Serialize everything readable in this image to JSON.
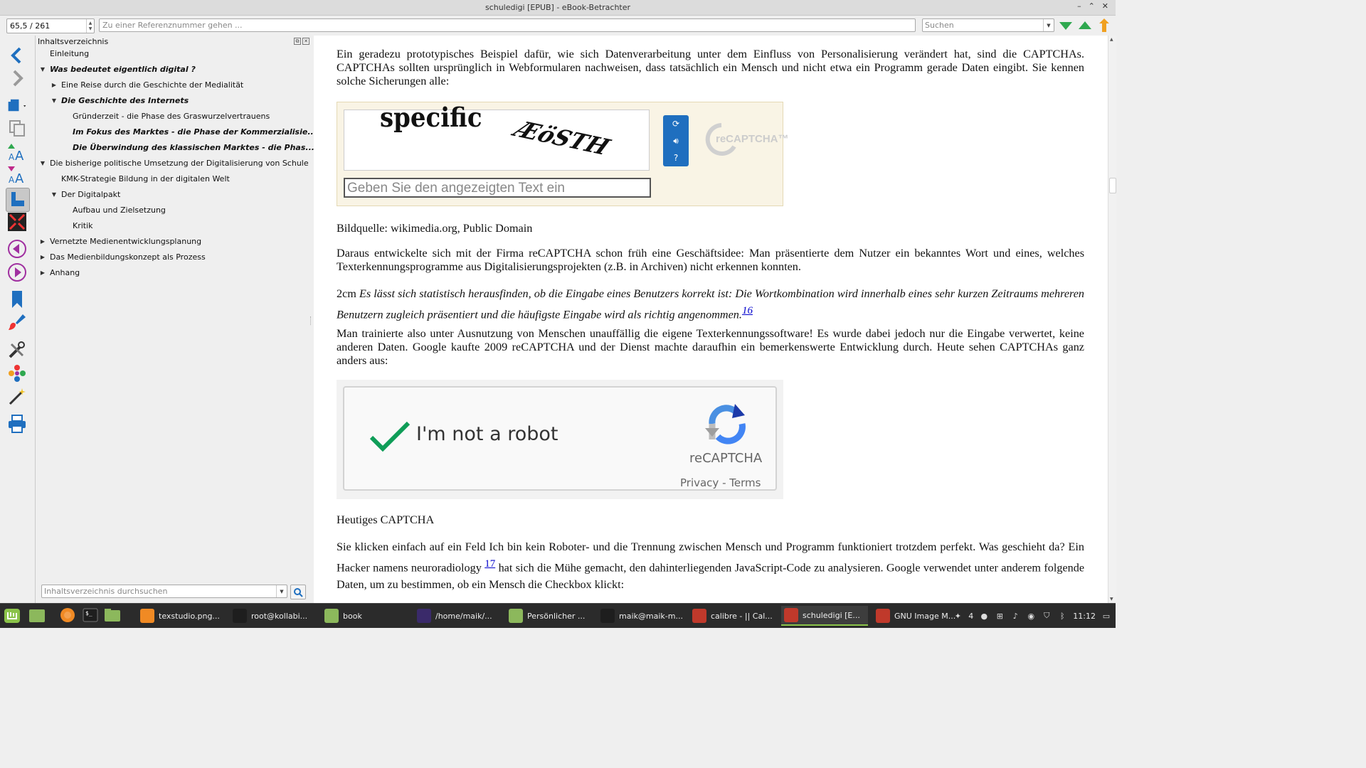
{
  "window": {
    "title": "schuledigi [EPUB] - eBook-Betrachter",
    "controls": [
      "–",
      "⌃",
      "✕"
    ]
  },
  "toolbar": {
    "page_position": "65,5 / 261",
    "reference_placeholder": "Zu einer Referenznummer gehen ...",
    "search_placeholder": "Suchen"
  },
  "toc": {
    "header": "Inhaltsverzeichnis",
    "search_placeholder": "Inhaltsverzeichnis durchsuchen",
    "items": [
      {
        "label": "Einleitung",
        "level": 0,
        "arrow": "",
        "bold": false
      },
      {
        "label": "Was bedeutet eigentlich digital ?",
        "level": 0,
        "arrow": "▼",
        "bold": true
      },
      {
        "label": "Eine Reise durch die Geschichte der Medialität",
        "level": 1,
        "arrow": "▶",
        "bold": false
      },
      {
        "label": "Die Geschichte des Internets",
        "level": 1,
        "arrow": "▼",
        "bold": true
      },
      {
        "label": "Gründerzeit - die Phase des Graswurzelvertrauens",
        "level": 2,
        "arrow": "",
        "bold": false
      },
      {
        "label": "Im Fokus des Marktes - die Phase der Kommerzialisie...",
        "level": 2,
        "arrow": "",
        "bold": true
      },
      {
        "label": "Die Überwindung des klassischen Marktes - die Phas...",
        "level": 2,
        "arrow": "",
        "bold": true
      },
      {
        "label": "Die bisherige politische Umsetzung der Digitalisierung von Schule",
        "level": 0,
        "arrow": "▼",
        "bold": false
      },
      {
        "label": "KMK-Strategie Bildung in der digitalen Welt",
        "level": 1,
        "arrow": "",
        "bold": false
      },
      {
        "label": "Der Digitalpakt",
        "level": 1,
        "arrow": "▼",
        "bold": false
      },
      {
        "label": "Aufbau und Zielsetzung",
        "level": 2,
        "arrow": "",
        "bold": false
      },
      {
        "label": "Kritik",
        "level": 2,
        "arrow": "",
        "bold": false
      },
      {
        "label": "Vernetzte Medienentwicklungsplanung",
        "level": 0,
        "arrow": "▶",
        "bold": false
      },
      {
        "label": "Das Medienbildungskonzept als Prozess",
        "level": 0,
        "arrow": "▶",
        "bold": false
      },
      {
        "label": "Anhang",
        "level": 0,
        "arrow": "▶",
        "bold": false
      }
    ]
  },
  "content": {
    "para1": "Ein geradezu prototypisches Beispiel dafür, wie sich Datenverarbeitung unter dem Einfluss von Personalisierung verändert hat, sind die CAPTCHAs. CAPTCHAs sollten ursprünglich in Webformularen nachweisen, dass tatsächlich ein Mensch und nicht etwa ein Programm gerade Daten eingibt. Sie kennen solche Sicherungen alle:",
    "captcha1": {
      "word1": "specific",
      "word2": "ÆöSTH",
      "input_placeholder": "Geben Sie den angezeigten Text ein",
      "logo": "reCAPTCHA™"
    },
    "caption1": "Bildquelle: wikimedia.org, Public Domain",
    "para2": "Daraus entwickelte sich mit der Firma reCAPTCHA schon früh eine Geschäftsidee: Man präsentierte dem Nutzer ein bekanntes Wort und eines, welches Texterkennungsprogramme aus Digitalisierungsprojekten (z.B. in Archiven) nicht erkennen konnten.",
    "para3_prefix": "2cm",
    "para3_italic": "Es lässt sich statistisch herausfinden, ob die Eingabe eines Benutzers korrekt ist: Die Wortkombination wird innerhalb eines sehr kurzen Zeitraums mehreren Benutzern zugleich präsentiert und die häufigste Eingabe wird als richtig angenommen.",
    "footnote16": "16",
    "para4": "Man trainierte also unter Ausnutzung von Menschen unauffällig die eigene Texterkennungssoftware! Es wurde dabei jedoch nur die Eingabe verwertet, keine anderen Daten. Google kaufte 2009 reCAPTCHA und der Dienst machte daraufhin ein bemerkenswerte Entwicklung durch. Heute sehen CAPTCHAs ganz anders aus:",
    "captcha2": {
      "label": "I'm not a robot",
      "brand": "reCAPTCHA",
      "privacy": "Privacy - Terms"
    },
    "caption2": "Heutiges CAPTCHA",
    "para5_a": "Sie klicken einfach auf ein Feld Ich bin kein Roboter- und die Trennung zwischen Mensch und Programm funktioniert trotzdem perfekt. Was geschieht da? Ein Hacker namens neuroradiology",
    "footnote17": "17",
    "para5_b": "hat sich die Mühe gemacht, den dahinterliegenden JavaScript-Code zu analysieren. Google verwendet unter anderem folgende Daten, um zu bestimmen, ob ein Mensch die Checkbox klickt:"
  },
  "taskbar": {
    "apps": [
      {
        "label": "texstudio.png...",
        "color": "#f08a24"
      },
      {
        "label": "root@kollabi...",
        "color": "#1e1e1e"
      },
      {
        "label": "book",
        "color": "#8cb85c"
      },
      {
        "label": "/home/maik/...",
        "color": "#3a2a6a"
      },
      {
        "label": "Persönlicher ...",
        "color": "#8cb85c"
      },
      {
        "label": "maik@maik-m...",
        "color": "#1e1e1e"
      },
      {
        "label": "calibre - || Cal...",
        "color": "#c0392b"
      },
      {
        "label": "schuledigi [E...",
        "color": "#c0392b"
      },
      {
        "label": "GNU Image M...",
        "color": "#c0392b"
      }
    ],
    "tray_count": "4",
    "clock": "11:12"
  },
  "colors": {
    "accent_blue": "#1f6fbf",
    "mint_green": "#8bc34a",
    "recaptcha_green": "#0f9d58"
  }
}
